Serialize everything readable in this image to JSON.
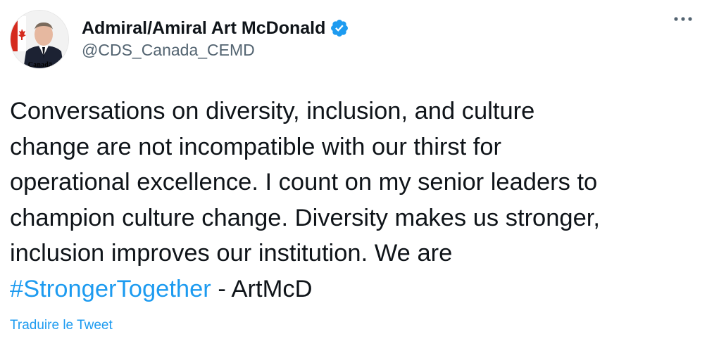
{
  "author": {
    "display_name": "Admiral/Amiral Art McDonald",
    "handle": "@CDS_Canada_CEMD",
    "verified": true,
    "avatar_wordmark": "Canadä",
    "avatar_icon": "profile-photo-with-canada-flag"
  },
  "tweet": {
    "text_before_hashtag": "Conversations on diversity, inclusion, and culture\nchange are not incompatible with our thirst for\noperational excellence. I count on my senior leaders to\nchampion culture change. Diversity makes us stronger,\ninclusion improves our institution. We are\n",
    "hashtag": "#StrongerTogether",
    "text_after_hashtag": " - ArtMcD"
  },
  "actions": {
    "more_icon": "more-horizontal-icon",
    "translate_label": "Traduire le Tweet"
  },
  "colors": {
    "accent": "#1d9bf0",
    "text": "#0f1419",
    "secondary_text": "#536471",
    "flag_red": "#d52b1e"
  }
}
